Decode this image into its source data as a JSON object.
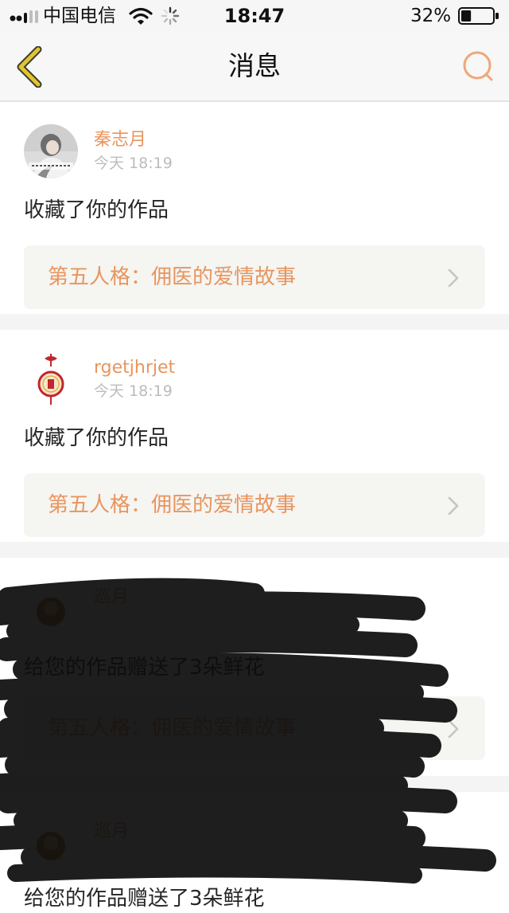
{
  "status_bar": {
    "carrier": "中国电信",
    "time": "18:47",
    "battery": "32%",
    "battery_level": 0.32,
    "icons": [
      "signal-icon",
      "wifi-icon",
      "loading-spinner-icon",
      "battery-icon"
    ]
  },
  "nav": {
    "title": "消息",
    "icons": [
      "back-chevron-icon",
      "search-icon"
    ]
  },
  "colors": {
    "accent": "#e8955e",
    "back_icon": "#e0c432",
    "search_icon": "#efa779",
    "timestamp": "#bcbcbc",
    "work_box_bg": "#f5f5f2",
    "separator": "#f4f4f4"
  },
  "notifications": [
    {
      "user": "秦志月",
      "time": "今天 18:19",
      "action": "收藏了你的作品",
      "work_title": "第五人格：佣医的爱情故事",
      "avatar": "photo-avatar-icon"
    },
    {
      "user": "rgetjhrjet",
      "time": "今天 18:19",
      "action": "收藏了你的作品",
      "work_title": "第五人格：佣医的爱情故事",
      "avatar": "fu-knot-avatar-icon"
    },
    {
      "user": "巡月",
      "time": "",
      "action": "给您的作品赠送了3朵鲜花",
      "work_title": "第五人格：佣医的爱情故事",
      "avatar": "avatar-icon"
    },
    {
      "user": "巡月",
      "time": "",
      "action": "给您的作品赠送了3朵鲜花",
      "work_title": "",
      "avatar": "avatar-icon"
    }
  ]
}
